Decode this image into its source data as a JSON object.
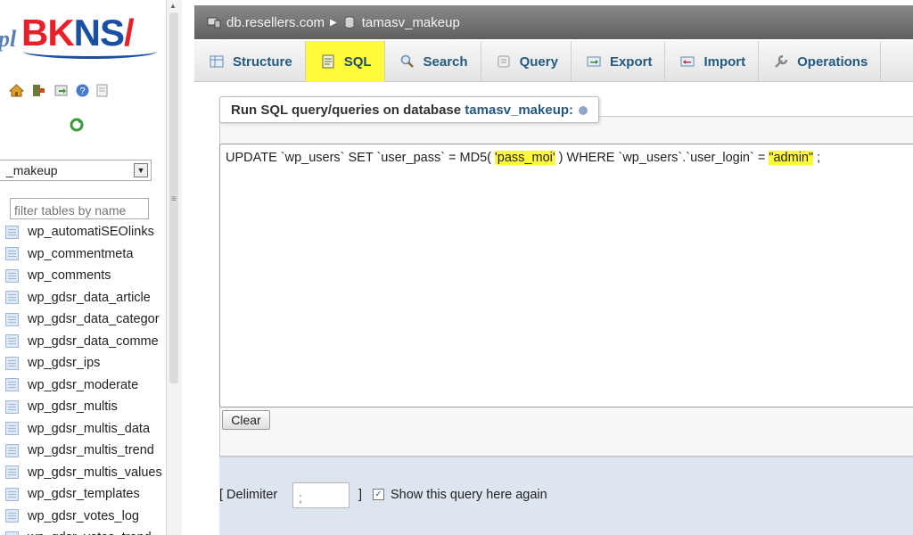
{
  "logo": {
    "prefix": "pl",
    "brand_part1": "BK",
    "brand_part2": "NS",
    "brand_part3": "/"
  },
  "sidebar": {
    "db_select_value": "_makeup",
    "filter_placeholder": "filter tables by name",
    "tables": [
      "wp_automatiSEOlinks",
      "wp_commentmeta",
      "wp_comments",
      "wp_gdsr_data_article",
      "wp_gdsr_data_categor",
      "wp_gdsr_data_comme",
      "wp_gdsr_ips",
      "wp_gdsr_moderate",
      "wp_gdsr_multis",
      "wp_gdsr_multis_data",
      "wp_gdsr_multis_trend",
      "wp_gdsr_multis_values",
      "wp_gdsr_templates",
      "wp_gdsr_votes_log",
      "wp_gdsr_votes_trend"
    ]
  },
  "breadcrumb": {
    "server": "db.resellers.com",
    "database": "tamasv_makeup"
  },
  "tabs": [
    {
      "label": "Structure",
      "icon": "structure-icon"
    },
    {
      "label": "SQL",
      "icon": "sql-icon",
      "active": true
    },
    {
      "label": "Search",
      "icon": "search-icon"
    },
    {
      "label": "Query",
      "icon": "query-icon"
    },
    {
      "label": "Export",
      "icon": "export-icon"
    },
    {
      "label": "Import",
      "icon": "import-icon"
    },
    {
      "label": "Operations",
      "icon": "wrench-icon"
    }
  ],
  "sql_panel": {
    "legend_prefix": "Run SQL query/queries on database ",
    "legend_db": "tamasv_makeup:",
    "query_part1": "UPDATE `wp_users` SET `user_pass` = MD5( ",
    "query_highlight1": "'pass_moi'",
    "query_part2": " ) WHERE `wp_users`.`user_login` = ",
    "query_highlight2": "\"admin\"",
    "query_part3": " ;",
    "clear_label": "Clear"
  },
  "options": {
    "delimiter_label": "[ Delimiter",
    "delimiter_value": ";",
    "delimiter_close": "]",
    "show_again_checked": true,
    "show_again_label": "Show this query here again"
  },
  "colors": {
    "highlight": "#fffb3a",
    "link_blue": "#235a81",
    "options_bg": "#dde5ee"
  }
}
